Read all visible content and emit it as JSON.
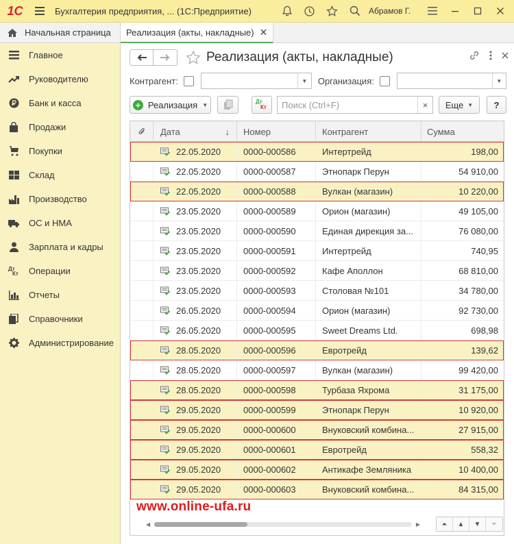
{
  "app": {
    "logo_text": "1С",
    "window_title": "Бухгалтерия предприятия, ... (1С:Предприятие)",
    "user": "Абрамов Г."
  },
  "tabs": {
    "home": "Начальная страница",
    "active": "Реализация (акты, накладные)"
  },
  "sidebar": {
    "items": [
      {
        "label": "Главное",
        "icon": "menu-lines-icon"
      },
      {
        "label": "Руководителю",
        "icon": "trend-icon"
      },
      {
        "label": "Банк и касса",
        "icon": "ruble-icon"
      },
      {
        "label": "Продажи",
        "icon": "shopping-bag-icon"
      },
      {
        "label": "Покупки",
        "icon": "cart-icon"
      },
      {
        "label": "Склад",
        "icon": "warehouse-icon"
      },
      {
        "label": "Производство",
        "icon": "factory-icon"
      },
      {
        "label": "ОС и НМА",
        "icon": "truck-icon"
      },
      {
        "label": "Зарплата и кадры",
        "icon": "person-icon"
      },
      {
        "label": "Операции",
        "icon": "dt-kt-icon"
      },
      {
        "label": "Отчеты",
        "icon": "bar-chart-icon"
      },
      {
        "label": "Справочники",
        "icon": "books-icon"
      },
      {
        "label": "Администрирование",
        "icon": "gear-icon"
      }
    ]
  },
  "form": {
    "title": "Реализация (акты, накладные)",
    "filter_counterparty_label": "Контрагент:",
    "filter_org_label": "Организация:",
    "create_button": "Реализация",
    "dtkt_top": "Дт",
    "dtkt_bottom": "Кт",
    "search_placeholder": "Поиск (Ctrl+F)",
    "search_clear": "×",
    "more_button": "Еще",
    "help_button": "?"
  },
  "table": {
    "headers": [
      "Дата",
      "Номер",
      "Контрагент",
      "Сумма"
    ],
    "sort_indicator": "↓",
    "rows": [
      {
        "date": "22.05.2020",
        "number": "0000-000586",
        "counterparty": "Интертрейд",
        "sum": "198,00",
        "highlighted": true
      },
      {
        "date": "22.05.2020",
        "number": "0000-000587",
        "counterparty": "Этнопарк Перун",
        "sum": "54 910,00",
        "highlighted": false
      },
      {
        "date": "22.05.2020",
        "number": "0000-000588",
        "counterparty": "Вулкан (магазин)",
        "sum": "10 220,00",
        "highlighted": true
      },
      {
        "date": "23.05.2020",
        "number": "0000-000589",
        "counterparty": "Орион (магазин)",
        "sum": "49 105,00",
        "highlighted": false
      },
      {
        "date": "23.05.2020",
        "number": "0000-000590",
        "counterparty": "Единая дирекция за...",
        "sum": "76 080,00",
        "highlighted": false
      },
      {
        "date": "23.05.2020",
        "number": "0000-000591",
        "counterparty": "Интертрейд",
        "sum": "740,95",
        "highlighted": false
      },
      {
        "date": "23.05.2020",
        "number": "0000-000592",
        "counterparty": "Кафе Аполлон",
        "sum": "68 810,00",
        "highlighted": false
      },
      {
        "date": "23.05.2020",
        "number": "0000-000593",
        "counterparty": "Столовая №101",
        "sum": "34 780,00",
        "highlighted": false
      },
      {
        "date": "26.05.2020",
        "number": "0000-000594",
        "counterparty": "Орион (магазин)",
        "sum": "92 730,00",
        "highlighted": false
      },
      {
        "date": "26.05.2020",
        "number": "0000-000595",
        "counterparty": "Sweet Dreams Ltd.",
        "sum": "698,98",
        "highlighted": false
      },
      {
        "date": "28.05.2020",
        "number": "0000-000596",
        "counterparty": "Евротрейд",
        "sum": "139,62",
        "highlighted": true
      },
      {
        "date": "28.05.2020",
        "number": "0000-000597",
        "counterparty": "Вулкан (магазин)",
        "sum": "99 420,00",
        "highlighted": false
      },
      {
        "date": "28.05.2020",
        "number": "0000-000598",
        "counterparty": "Турбаза Яхрома",
        "sum": "31 175,00",
        "highlighted": true
      },
      {
        "date": "29.05.2020",
        "number": "0000-000599",
        "counterparty": "Этнопарк Перун",
        "sum": "10 920,00",
        "highlighted": true
      },
      {
        "date": "29.05.2020",
        "number": "0000-000600",
        "counterparty": "Внуковский комбина...",
        "sum": "27 915,00",
        "highlighted": true
      },
      {
        "date": "29.05.2020",
        "number": "0000-000601",
        "counterparty": "Евротрейд",
        "sum": "558,32",
        "highlighted": true
      },
      {
        "date": "29.05.2020",
        "number": "0000-000602",
        "counterparty": "Антикафе Земляника",
        "sum": "10 400,00",
        "highlighted": true
      },
      {
        "date": "29.05.2020",
        "number": "0000-000603",
        "counterparty": "Внуковский комбина...",
        "sum": "84 315,00",
        "highlighted": true
      }
    ]
  },
  "watermark": "www.online-ufa.ru",
  "colors": {
    "titlebar": "#fbed9e",
    "sidebar": "#fbf2c4",
    "highlight_row": "#fbf2c4",
    "highlight_border": "#d23b3b",
    "accent_green": "#3fa93f",
    "watermark": "#e01b1b"
  }
}
